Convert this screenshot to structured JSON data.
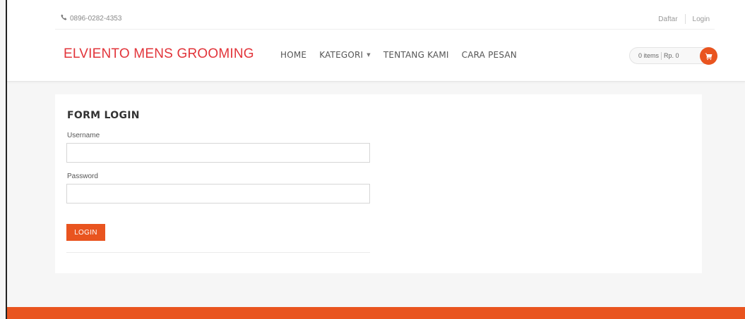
{
  "topbar": {
    "phone": "0896-0282-4353",
    "phone_icon": "phone-icon",
    "register_label": "Daftar",
    "login_label": "Login"
  },
  "header": {
    "brand": "ELVIENTO MENS GROOMING",
    "nav": {
      "home": "HOME",
      "kategori": "KATEGORI",
      "tentang": "TENTANG KAMI",
      "cara_pesan": "CARA PESAN"
    },
    "cart": {
      "items": "0 items",
      "total": "Rp. 0",
      "icon": "shopping-cart-icon"
    }
  },
  "form": {
    "title": "FORM LOGIN",
    "username_label": "Username",
    "username_value": "",
    "password_label": "Password",
    "password_value": "",
    "submit_label": "LOGIN"
  },
  "colors": {
    "brand": "#e2343a",
    "accent": "#e9541f",
    "page_bg": "#f6f6f6"
  }
}
